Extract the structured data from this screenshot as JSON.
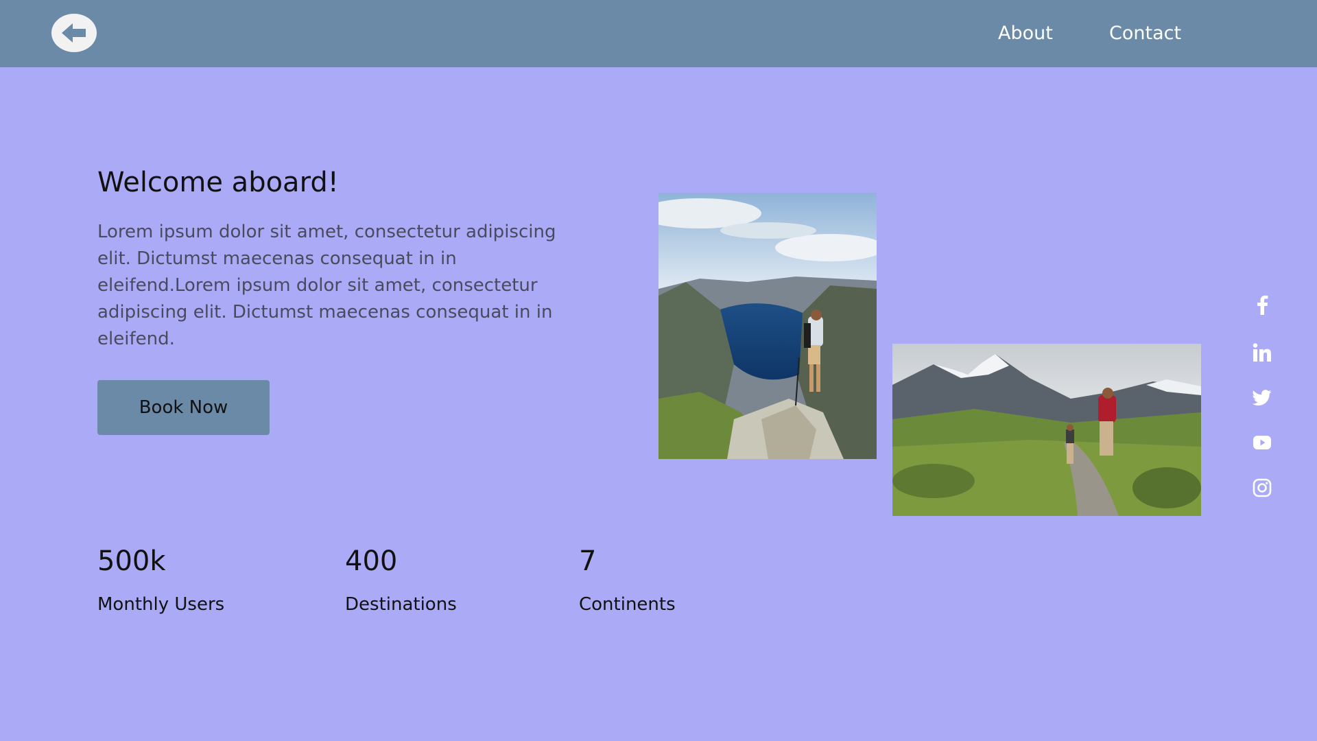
{
  "colors": {
    "background": "#abaaf6",
    "header": "#6a8aa8",
    "button": "#6a8aa8"
  },
  "header": {
    "back_icon": "arrow-left-icon",
    "nav": [
      {
        "label": "About"
      },
      {
        "label": "Contact"
      }
    ]
  },
  "hero": {
    "title": "Welcome aboard!",
    "body": "Lorem ipsum dolor sit amet, consectetur adipiscing elit. Dictumst maecenas consequat in in eleifend.Lorem ipsum dolor sit amet, consectetur adipiscing elit. Dictumst maecenas consequat in in eleifend.",
    "cta_label": "Book Now"
  },
  "images": [
    {
      "subject": "hiker overlooking fjord"
    },
    {
      "subject": "hikers on mountain trail"
    }
  ],
  "social": [
    {
      "icon": "facebook-icon"
    },
    {
      "icon": "linkedin-icon"
    },
    {
      "icon": "twitter-icon"
    },
    {
      "icon": "youtube-icon"
    },
    {
      "icon": "instagram-icon"
    }
  ],
  "stats": [
    {
      "value": "500k",
      "label": "Monthly Users"
    },
    {
      "value": "400",
      "label": "Destinations"
    },
    {
      "value": "7",
      "label": "Continents"
    }
  ]
}
